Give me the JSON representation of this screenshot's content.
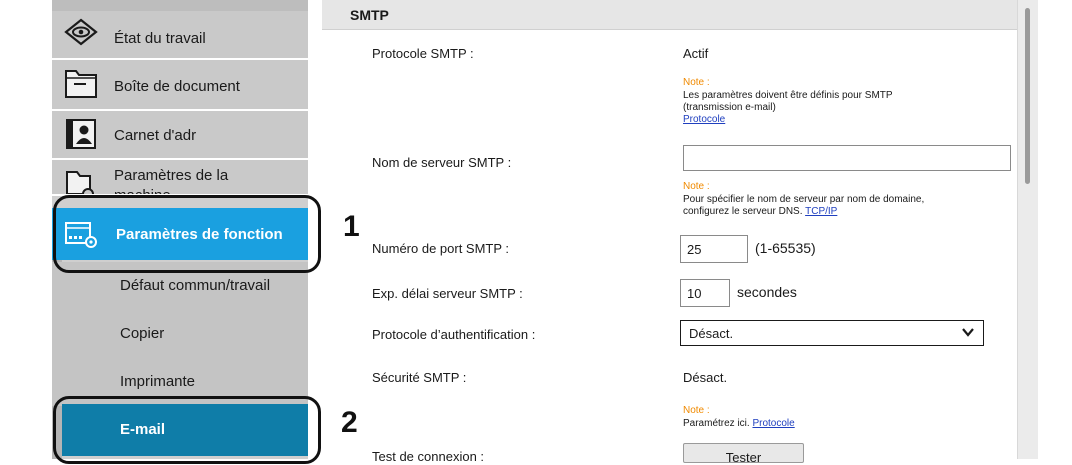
{
  "sidebar": {
    "items": [
      {
        "label": "État du travail",
        "icon": "eye-icon"
      },
      {
        "label": "Boîte de document",
        "icon": "folder-icon"
      },
      {
        "label": "Carnet d'adr",
        "icon": "address-book-icon"
      },
      {
        "label": "Paramètres de la machine",
        "icon": "machine-settings-icon"
      },
      {
        "label": "Paramètres de fonction",
        "icon": "function-settings-icon"
      }
    ],
    "subitems": [
      {
        "label": "Défaut commun/travail"
      },
      {
        "label": "Copier"
      },
      {
        "label": "Imprimante"
      },
      {
        "label": "E-mail"
      }
    ]
  },
  "section": {
    "title": "SMTP"
  },
  "form": {
    "smtp_protocol": {
      "label": "Protocole SMTP :",
      "value": "Actif"
    },
    "note1": {
      "heading": "Note :",
      "line1": "Les paramètres doivent être définis pour SMTP",
      "line2": "(transmission e-mail)",
      "link": "Protocole"
    },
    "server_name": {
      "label": "Nom de serveur SMTP :",
      "value": ""
    },
    "note2": {
      "heading": "Note :",
      "line1": "Pour spécifier le nom de serveur par nom de domaine,",
      "line2": "configurez le serveur DNS.",
      "link": "TCP/IP"
    },
    "port": {
      "label": "Numéro de port SMTP :",
      "value": "25",
      "range": "(1-65535)"
    },
    "timeout": {
      "label": "Exp. délai serveur SMTP :",
      "value": "10",
      "unit": "secondes"
    },
    "auth": {
      "label": "Protocole d’authentification :",
      "value": "Désact."
    },
    "security": {
      "label": "Sécurité SMTP :",
      "value": "Désact."
    },
    "note3": {
      "heading": "Note :",
      "line1": "Paramétrez ici.",
      "link": "Protocole"
    },
    "test": {
      "label": "Test de connexion :",
      "button": "Tester"
    }
  },
  "callouts": {
    "one": "1",
    "two": "2"
  },
  "colors": {
    "active_item": "#1aa0e0",
    "email_item": "#0f7da8",
    "note": "#f08a00",
    "link": "#1f3fbf"
  }
}
